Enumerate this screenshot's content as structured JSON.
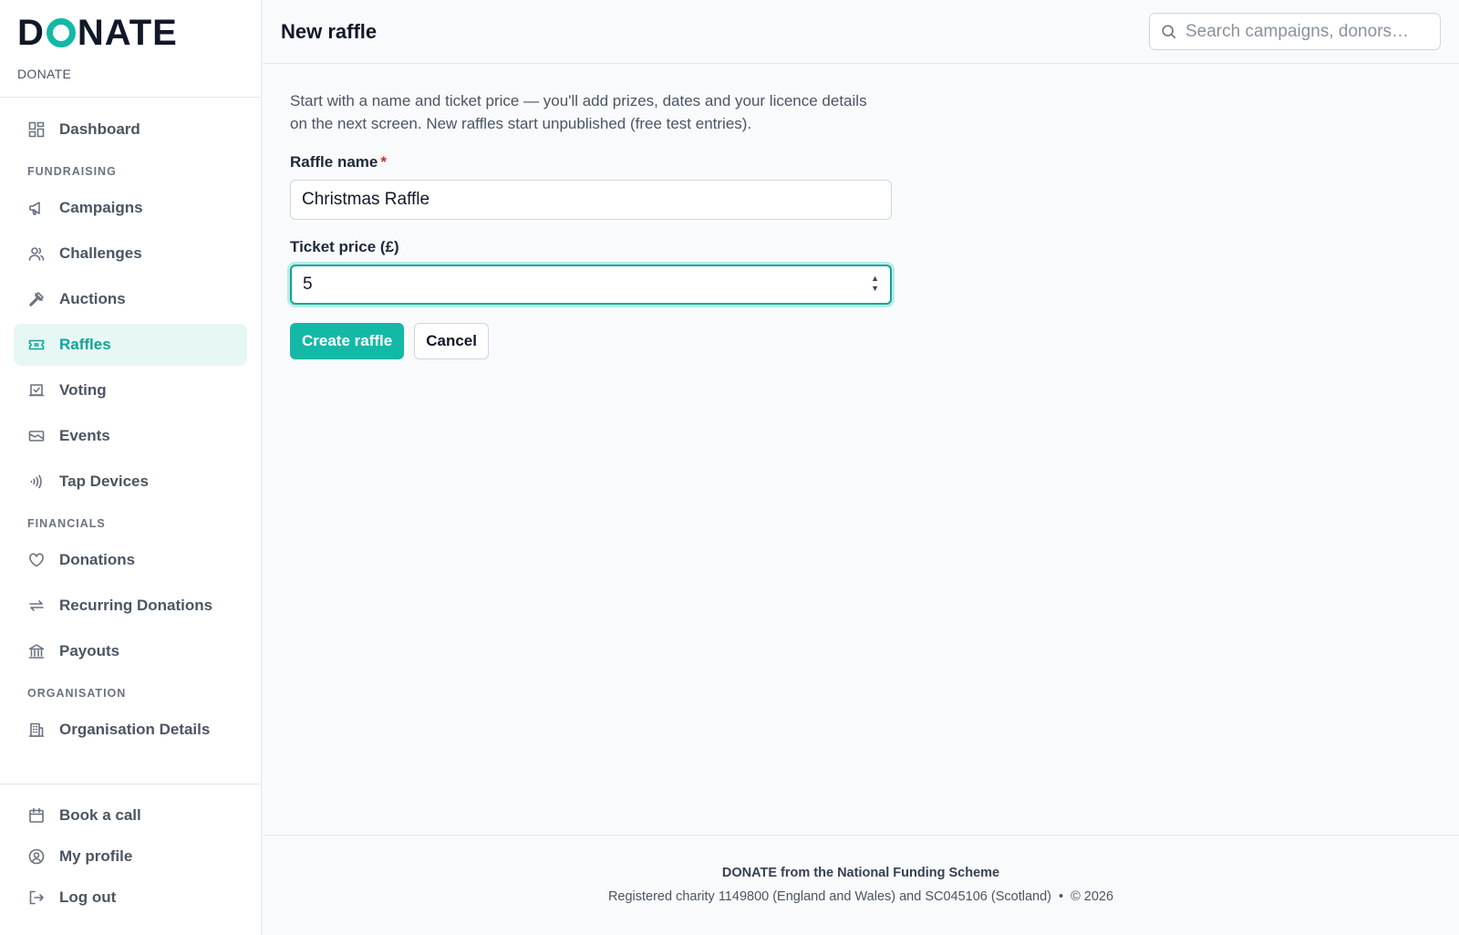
{
  "brand": {
    "logo_text_left": "D",
    "logo_text_right": "NATE",
    "subtitle": "DONATE",
    "accent_color": "#14b8a6"
  },
  "sidebar": {
    "dashboard": {
      "label": "Dashboard",
      "icon": "dashboard-icon"
    },
    "sections": [
      {
        "title": "FUNDRAISING",
        "items": [
          {
            "label": "Campaigns",
            "icon": "megaphone-icon"
          },
          {
            "label": "Challenges",
            "icon": "users-icon"
          },
          {
            "label": "Auctions",
            "icon": "gavel-icon"
          },
          {
            "label": "Raffles",
            "icon": "ticket-icon",
            "active": true
          },
          {
            "label": "Voting",
            "icon": "ballot-icon"
          },
          {
            "label": "Events",
            "icon": "event-ticket-icon"
          },
          {
            "label": "Tap Devices",
            "icon": "contactless-icon"
          }
        ]
      },
      {
        "title": "FINANCIALS",
        "items": [
          {
            "label": "Donations",
            "icon": "heart-icon"
          },
          {
            "label": "Recurring Donations",
            "icon": "repeat-icon"
          },
          {
            "label": "Payouts",
            "icon": "bank-icon"
          }
        ]
      },
      {
        "title": "ORGANISATION",
        "items": [
          {
            "label": "Organisation Details",
            "icon": "building-icon"
          }
        ]
      }
    ],
    "bottom": [
      {
        "label": "Book a call",
        "icon": "calendar-icon"
      },
      {
        "label": "My profile",
        "icon": "user-circle-icon"
      },
      {
        "label": "Log out",
        "icon": "logout-icon"
      }
    ]
  },
  "header": {
    "title": "New raffle",
    "search_placeholder": "Search campaigns, donors…"
  },
  "form": {
    "intro": "Start with a name and ticket price — you'll add prizes, dates and your licence details on the next screen. New raffles start unpublished (free test entries).",
    "name_label": "Raffle name",
    "required_marker": "*",
    "name_value": "Christmas Raffle",
    "price_label": "Ticket price (£)",
    "price_value": "5",
    "create_label": "Create raffle",
    "cancel_label": "Cancel"
  },
  "footer": {
    "title": "DONATE from the National Funding Scheme",
    "registration": "Registered charity 1149800 (England and Wales) and SC045106 (Scotland)",
    "separator": "•",
    "copyright": "© 2026"
  }
}
